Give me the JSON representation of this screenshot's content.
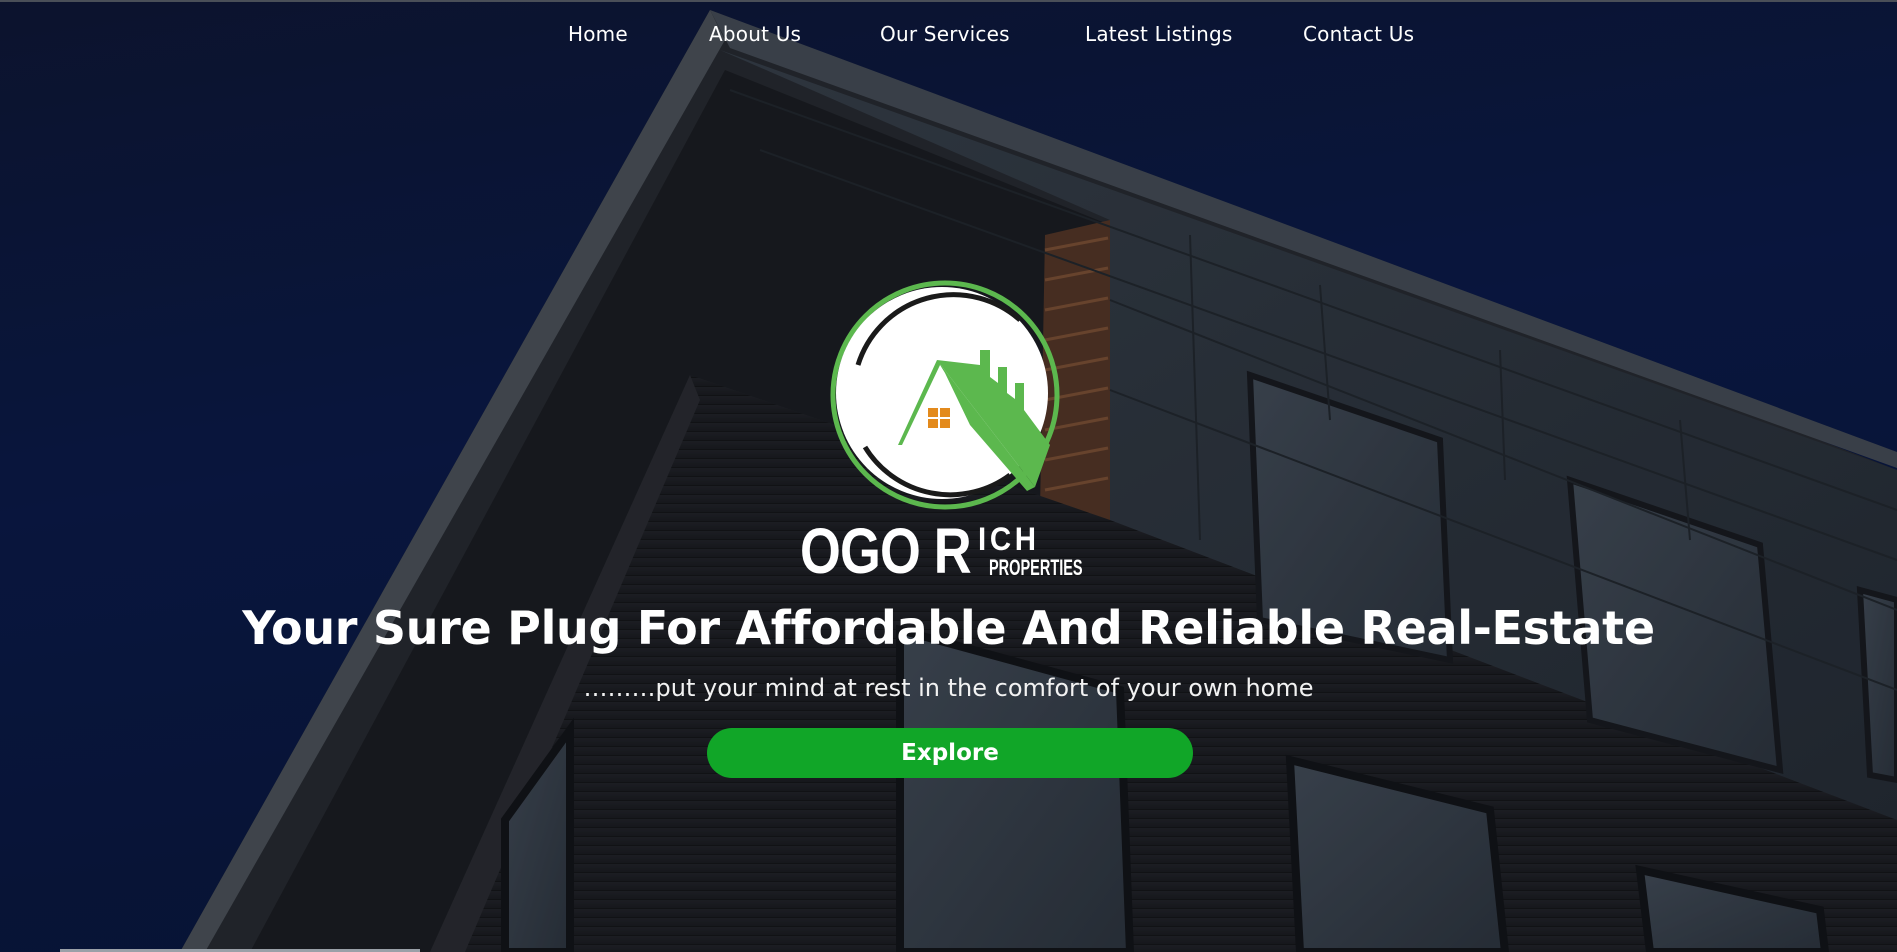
{
  "nav": {
    "items": [
      {
        "label": "Home"
      },
      {
        "label": "About Us"
      },
      {
        "label": "Our Services"
      },
      {
        "label": "Latest Listings"
      },
      {
        "label": "Contact Us"
      }
    ]
  },
  "logo": {
    "word_1": "OGO R",
    "word_2": "ICH",
    "word_3": "PROPERTIES",
    "icon": "house-roof-icon"
  },
  "hero": {
    "headline": "Your Sure Plug For Affordable And Reliable Real-Estate",
    "tagline": "………put your mind at rest in the comfort of your own home",
    "cta_label": "Explore"
  },
  "colors": {
    "sky": "#0b1840",
    "brand_green": "#5cb84e",
    "button_green": "#11a628",
    "window_orange": "#e38a1c"
  }
}
